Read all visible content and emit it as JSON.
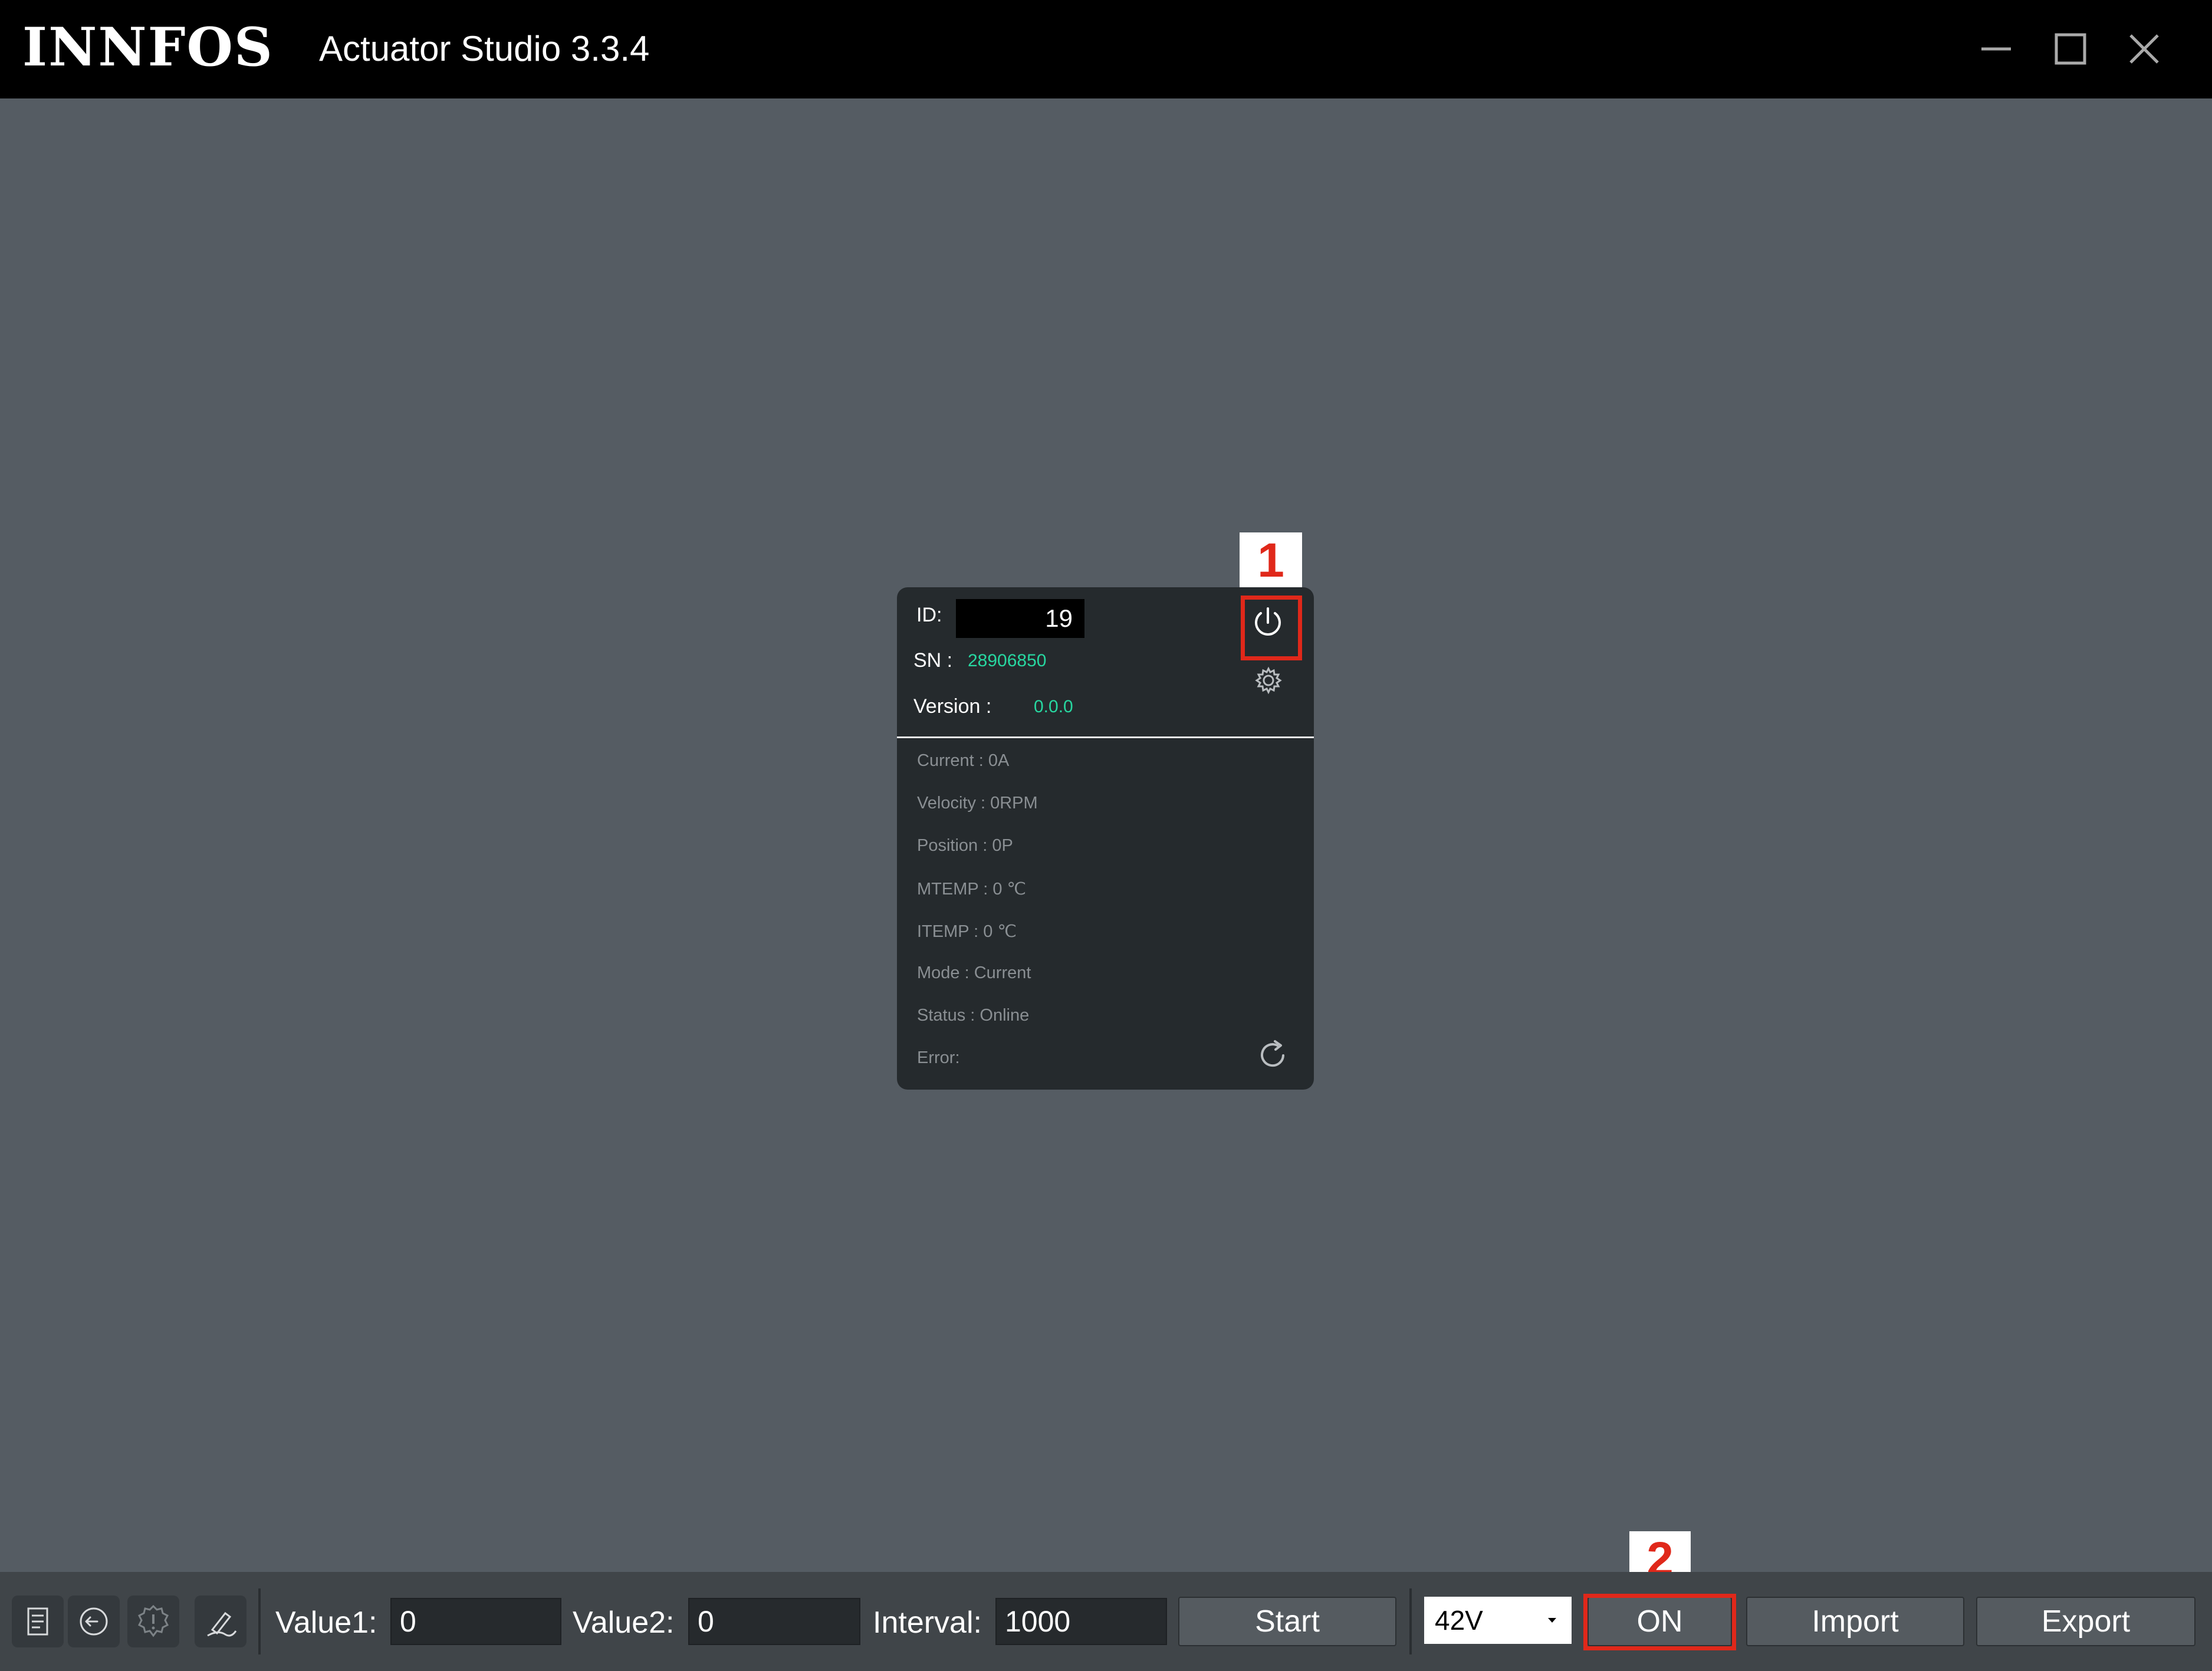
{
  "window": {
    "logo": "INNFOS",
    "title": "Actuator Studio 3.3.4"
  },
  "card": {
    "id_label": "ID:",
    "id_value": "19",
    "sn_label": "SN :",
    "sn_value": "28906850",
    "version_label": "Version :",
    "version_value": "0.0.0",
    "stats": [
      "Current : 0A",
      "Velocity : 0RPM",
      "Position : 0P",
      "MTEMP : 0 ℃",
      "ITEMP : 0 ℃",
      "Mode : Current",
      "Status : Online",
      "Error:"
    ]
  },
  "annotations": {
    "one": "1",
    "two": "2",
    "color": "#e0281a"
  },
  "toolbar": {
    "icons": [
      "list-icon",
      "exit-icon",
      "alert-icon",
      "pen-icon"
    ],
    "value1_label": "Value1:",
    "value1": "0",
    "value2_label": "Value2:",
    "value2": "0",
    "interval_label": "Interval:",
    "interval": "1000",
    "start_label": "Start",
    "voltage": "42V",
    "on_label": "ON",
    "import_label": "Import",
    "export_label": "Export"
  },
  "colors": {
    "accent_green": "#27d7a0",
    "workspace_bg": "#555c63"
  }
}
